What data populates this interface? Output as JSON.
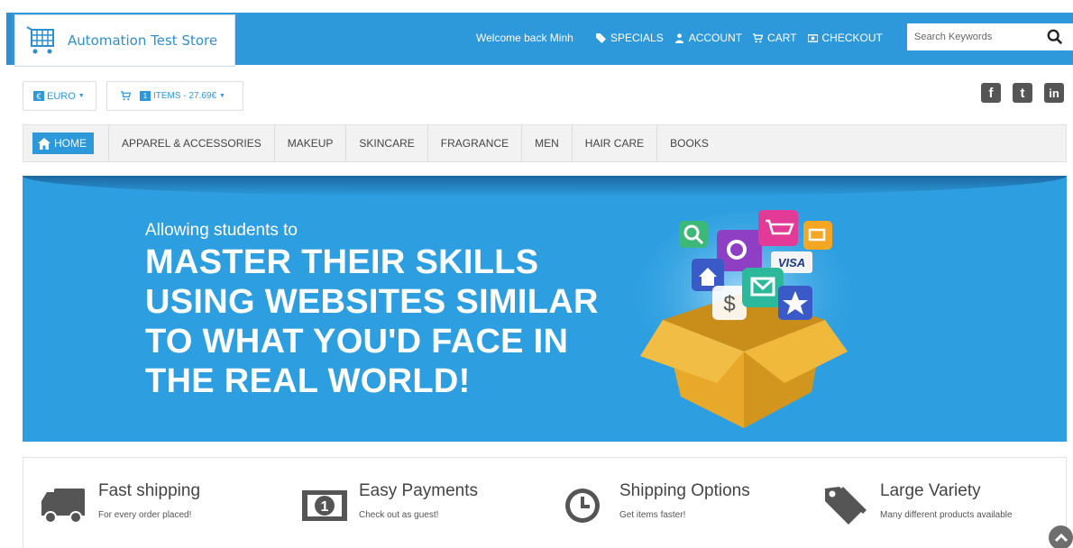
{
  "header": {
    "store_name": "Automation Test Store",
    "welcome": "Welcome back Minh",
    "nav": [
      {
        "label": "SPECIALS",
        "icon": "tag-icon"
      },
      {
        "label": "ACCOUNT",
        "icon": "user-icon"
      },
      {
        "label": "CART",
        "icon": "cart-icon"
      },
      {
        "label": "CHECKOUT",
        "icon": "money-icon"
      }
    ],
    "search_placeholder": "Search Keywords",
    "colors": {
      "primary": "#2d98da"
    }
  },
  "toolbar": {
    "currency_symbol": "€",
    "currency_label": "EURO",
    "cart_count": "1",
    "cart_summary": "ITEMS - 27.69€"
  },
  "social": [
    {
      "name": "facebook-icon",
      "glyph": "f"
    },
    {
      "name": "twitter-icon",
      "glyph": "t"
    },
    {
      "name": "linkedin-icon",
      "glyph": "in"
    }
  ],
  "categories": {
    "home": "HOME",
    "items": [
      "APPAREL & ACCESSORIES",
      "MAKEUP",
      "SKINCARE",
      "FRAGRANCE",
      "MEN",
      "HAIR CARE",
      "BOOKS"
    ]
  },
  "banner": {
    "subtitle": "Allowing students to",
    "headline_lines": [
      "MASTER THEIR SKILLS",
      "USING WEBSITES SIMILAR",
      "TO WHAT YOU'D FACE IN",
      "THE REAL WORLD!"
    ],
    "art_card_label": "VISA"
  },
  "features": [
    {
      "title": "Fast shipping",
      "subtitle": "For every order placed!",
      "icon": "truck-icon"
    },
    {
      "title": "Easy Payments",
      "subtitle": "Check out as guest!",
      "icon": "money-bill-icon"
    },
    {
      "title": "Shipping Options",
      "subtitle": "Get items faster!",
      "icon": "clock-icon"
    },
    {
      "title": "Large Variety",
      "subtitle": "Many different products available",
      "icon": "tags-icon"
    }
  ]
}
